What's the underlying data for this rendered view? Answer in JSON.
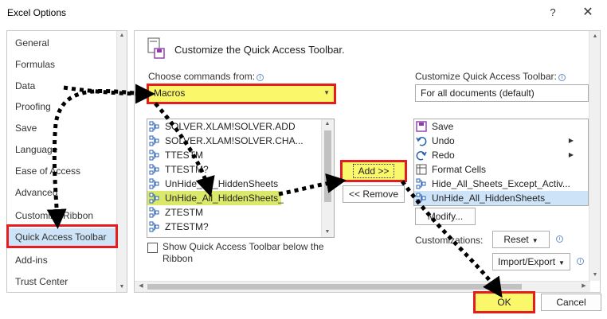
{
  "window": {
    "title": "Excel Options",
    "help_label": "?",
    "close_label": "✕"
  },
  "sidebar": {
    "items": [
      {
        "label": "General"
      },
      {
        "label": "Formulas"
      },
      {
        "label": "Data"
      },
      {
        "label": "Proofing"
      },
      {
        "label": "Save"
      },
      {
        "label": "Language"
      },
      {
        "label": "Ease of Access"
      },
      {
        "label": "Advanced"
      },
      {
        "label": "Customize Ribbon"
      },
      {
        "label": "Quick Access Toolbar"
      },
      {
        "label": "Add-ins"
      },
      {
        "label": "Trust Center"
      }
    ],
    "selected": "Quick Access Toolbar"
  },
  "main": {
    "heading": "Customize the Quick Access Toolbar.",
    "choose_label": "Choose commands from:",
    "choose_value": "Macros",
    "customize_label": "Customize Quick Access Toolbar:",
    "customize_value": "For all documents (default)",
    "commands": [
      {
        "label": "SOLVER.XLAM!SOLVER.ADD"
      },
      {
        "label": "SOLVER.XLAM!SOLVER.CHA..."
      },
      {
        "label": "TTESTM"
      },
      {
        "label": "TTESTM?"
      },
      {
        "label": "UnHide_All_HiddenSheets"
      },
      {
        "label": "UnHide_All_HiddenSheets_"
      },
      {
        "label": "ZTESTM"
      },
      {
        "label": "ZTESTM?"
      }
    ],
    "toolbar_items": [
      {
        "label": "Save",
        "icon": "save-icon"
      },
      {
        "label": "Undo",
        "icon": "undo-icon"
      },
      {
        "label": "Redo",
        "icon": "redo-icon"
      },
      {
        "label": "Format Cells",
        "icon": "format-cells-icon"
      },
      {
        "label": "Hide_All_Sheets_Except_Activ...",
        "icon": "macro-icon"
      },
      {
        "label": "UnHide_All_HiddenSheets_",
        "icon": "macro-icon"
      }
    ],
    "add_label": "Add >>",
    "remove_label": "<< Remove",
    "modify_label": "Modify...",
    "customizations_label": "Customizations:",
    "reset_label": "Reset",
    "import_export_label": "Import/Export",
    "show_below_label": "Show Quick Access Toolbar below the Ribbon",
    "show_below_checked": false
  },
  "footer": {
    "ok_label": "OK",
    "cancel_label": "Cancel"
  },
  "colors": {
    "highlight_yellow": "#fbf76a",
    "annotation_red": "#e41e1e",
    "selection_blue": "#cde3f7"
  }
}
